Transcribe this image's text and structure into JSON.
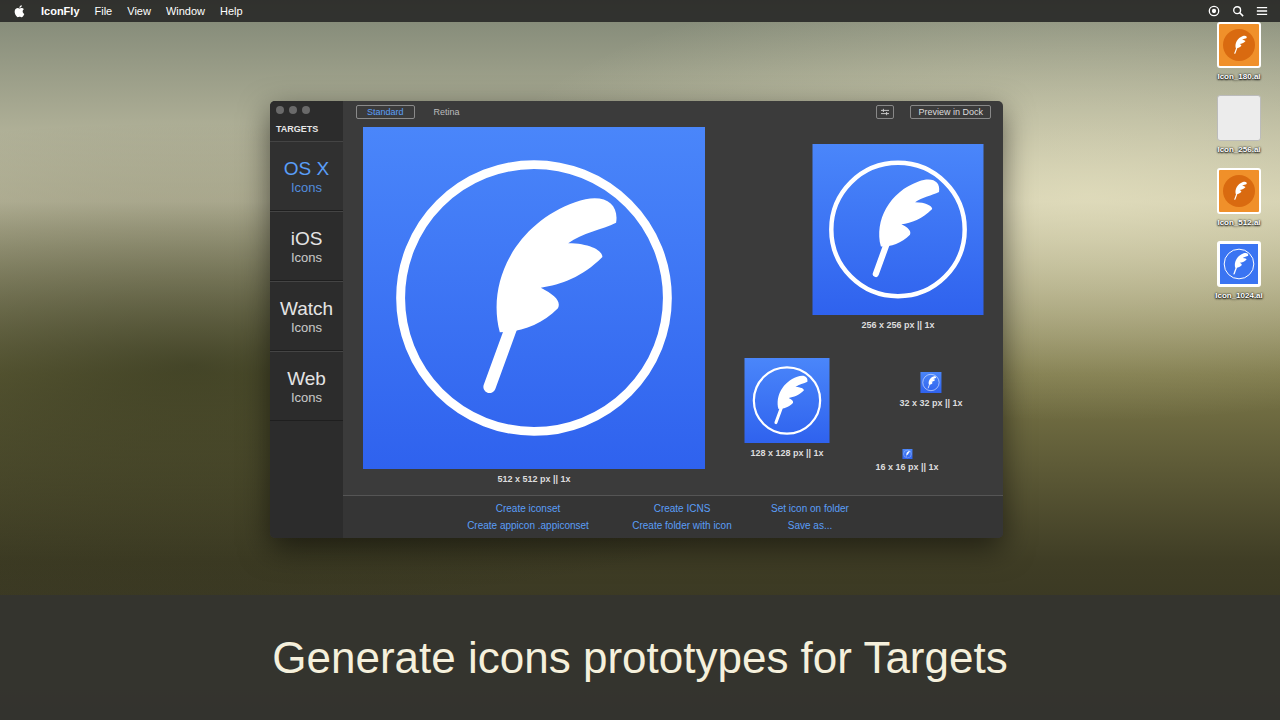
{
  "menu_bar": {
    "app": "IconFly",
    "items": [
      "File",
      "View",
      "Window",
      "Help"
    ]
  },
  "desktop_icons": [
    {
      "label": "Icon_180.ai",
      "kind": "ai"
    },
    {
      "label": "Icon_256.ai",
      "kind": "blank"
    },
    {
      "label": "Icon_512.ai",
      "kind": "ai"
    },
    {
      "label": "Icon_1024.ai",
      "kind": "preview"
    }
  ],
  "window": {
    "sidebar_title": "TARGETS",
    "targets": [
      {
        "title": "OS X",
        "subtitle": "Icons",
        "selected": true
      },
      {
        "title": "iOS",
        "subtitle": "Icons",
        "selected": false
      },
      {
        "title": "Watch",
        "subtitle": "Icons",
        "selected": false
      },
      {
        "title": "Web",
        "subtitle": "Icons",
        "selected": false
      }
    ],
    "modes": [
      {
        "label": "Standard",
        "selected": true
      },
      {
        "label": "Retina",
        "selected": false
      }
    ],
    "preview_button": "Preview in Dock",
    "previews": [
      {
        "label": "512 x 512 px || 1x"
      },
      {
        "label": "256 x 256 px || 1x"
      },
      {
        "label": "128 x 128 px || 1x"
      },
      {
        "label": "32 x 32 px || 1x"
      },
      {
        "label": "16 x 16 px || 1x"
      }
    ],
    "actions": [
      "Create iconset",
      "Create ICNS",
      "Set icon on folder",
      "Create appicon .appiconset",
      "Create folder with icon",
      "Save as..."
    ]
  },
  "caption": "Generate icons prototypes for Targets"
}
